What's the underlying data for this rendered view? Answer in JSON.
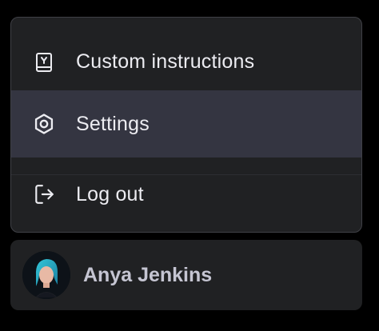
{
  "menu": {
    "items": [
      {
        "label": "Custom instructions",
        "icon": "book-icon"
      },
      {
        "label": "Settings",
        "icon": "gear-icon"
      },
      {
        "label": "Log out",
        "icon": "logout-icon"
      }
    ],
    "highlighted_index": 1
  },
  "profile": {
    "name": "Anya Jenkins",
    "avatar": "user-avatar"
  },
  "colors": {
    "background": "#000000",
    "menu_bg": "#202123",
    "highlight_bg": "#343541",
    "text": "#ececf1"
  }
}
